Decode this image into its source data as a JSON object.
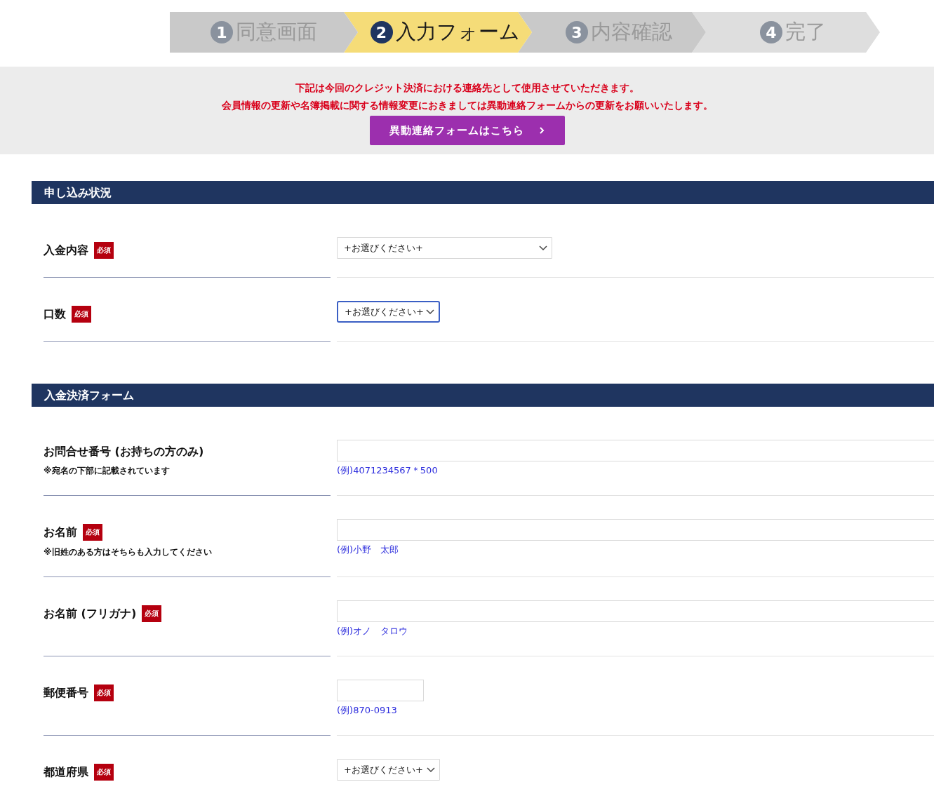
{
  "steps": [
    {
      "number": "1",
      "label": "同意画面",
      "selected": false,
      "color": "#c9c9c9"
    },
    {
      "number": "2",
      "label": "入力フォーム",
      "selected": true,
      "color": "#f5dc78"
    },
    {
      "number": "3",
      "label": "内容確認",
      "selected": false,
      "color": "#c9c9c9"
    },
    {
      "number": "4",
      "label": "完了",
      "selected": false,
      "color": "#dedede"
    }
  ],
  "notice": {
    "lines": [
      "下記は今回のクレジット決済における連絡先として使用させていただきます。",
      "会員情報の更新や名簿掲載に関する情報変更におきましては異動連絡フォームからの更新をお願いいたします。"
    ],
    "button": "異動連絡フォームはこちら"
  },
  "sections": [
    {
      "title": "申し込み状況",
      "rows": [
        {
          "label": "入金内容",
          "badge": "必須",
          "field": {
            "kind": "select",
            "value": "+お選びください+",
            "wide": true,
            "focused": false
          }
        },
        {
          "label": "口数",
          "badge": "必須",
          "field": {
            "kind": "select",
            "value": "+お選びください+",
            "wide": false,
            "focused": true
          }
        }
      ]
    },
    {
      "title": "入金決済フォーム",
      "rows": [
        {
          "label": "お問合せ番号 (お持ちの方のみ)",
          "note": "※宛名の下部に記載されています",
          "field": {
            "kind": "text",
            "wide": true
          },
          "hint": "(例)4071234567＊500"
        },
        {
          "label": "お名前",
          "badge": "必須",
          "note": "※旧姓のある方はそちらも入力してください",
          "field": {
            "kind": "text",
            "wide": true
          },
          "hint": "(例)小野　太郎"
        },
        {
          "label": "お名前 (フリガナ)",
          "badge": "必須",
          "field": {
            "kind": "text",
            "wide": true
          },
          "hint": "(例)オノ　タロウ"
        },
        {
          "label": "郵便番号",
          "badge": "必須",
          "field": {
            "kind": "text",
            "wide": false
          },
          "hint": "(例)870-0913"
        },
        {
          "label": "都道府県",
          "badge": "必須",
          "field": {
            "kind": "select",
            "value": "+お選びください+",
            "wide": false,
            "focused": false
          }
        }
      ]
    }
  ]
}
